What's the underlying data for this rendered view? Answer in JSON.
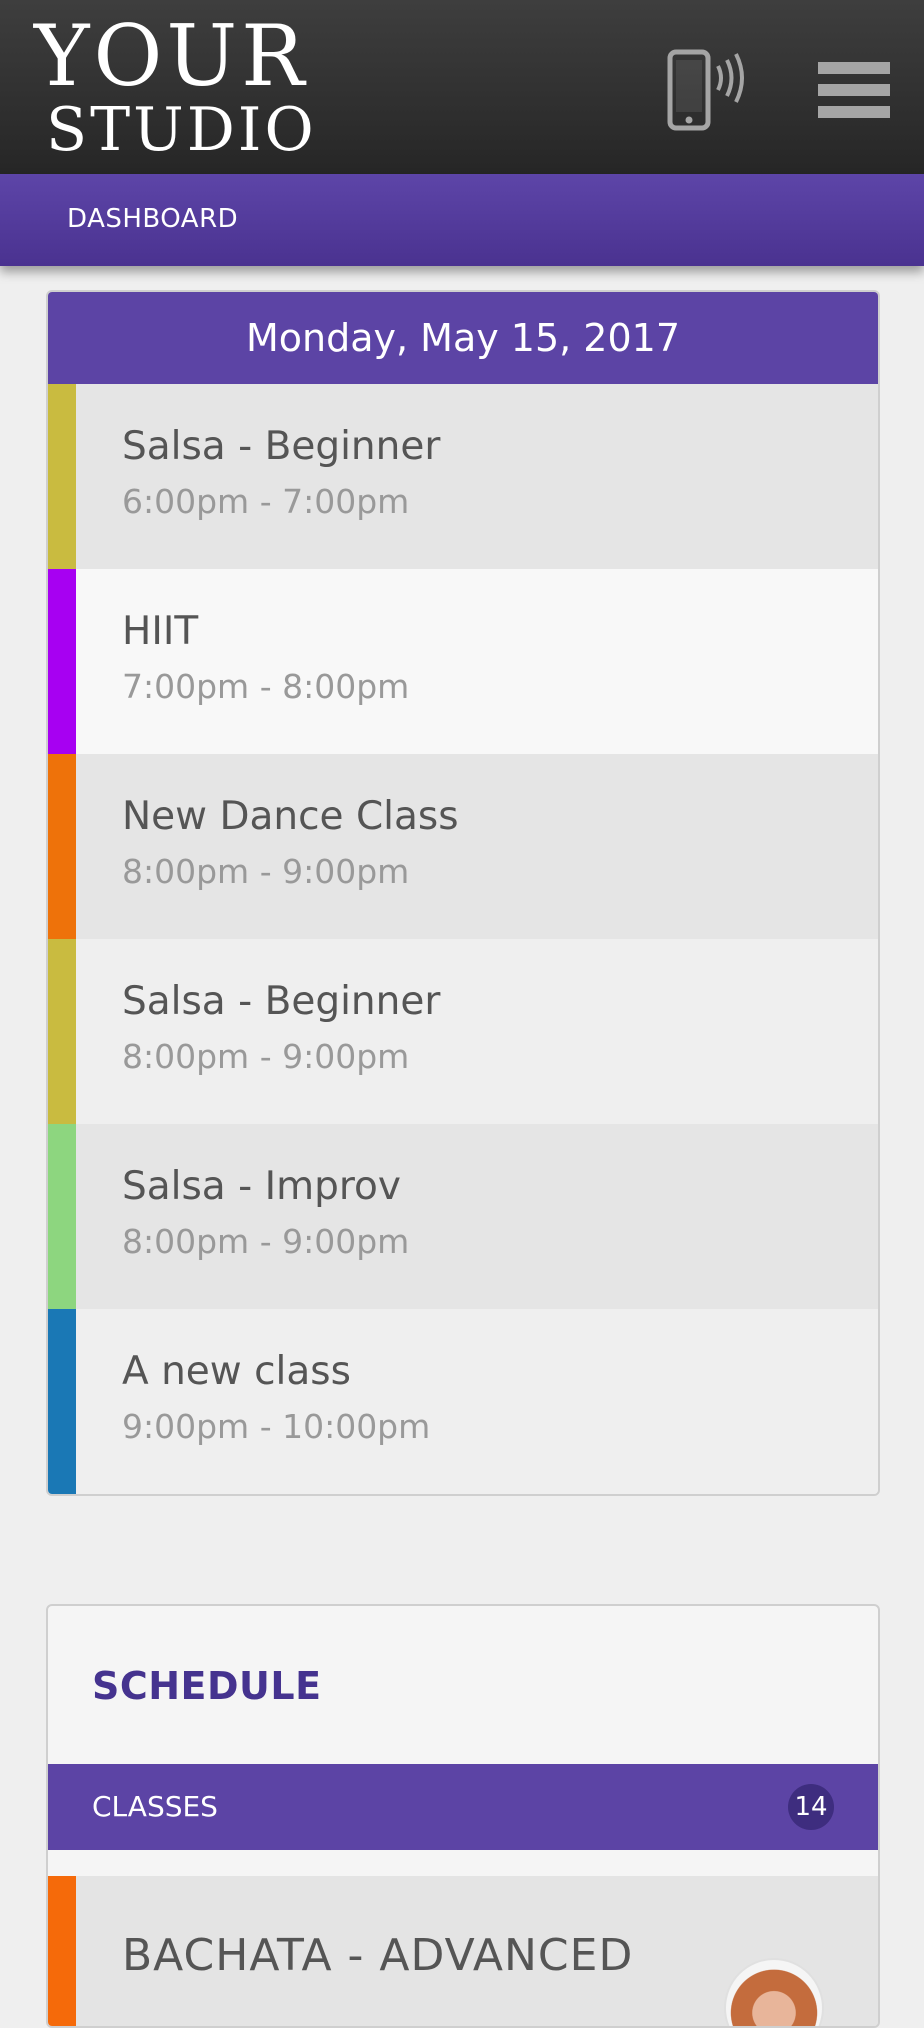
{
  "header": {
    "logo_line1": "YOUR",
    "logo_line2": "STUDIO",
    "phone_icon": "phone-vibrate-icon",
    "menu_icon": "hamburger-menu-icon"
  },
  "nav": {
    "dashboard": "DASHBOARD"
  },
  "day": {
    "date": "Monday, May 15, 2017",
    "classes": [
      {
        "title": "Salsa - Beginner",
        "time": "6:00pm - 7:00pm",
        "color": "#c9bb40",
        "bg": "#e5e5e5"
      },
      {
        "title": "HIIT",
        "time": "7:00pm - 8:00pm",
        "color": "#a700f2",
        "bg": "#f8f8f8"
      },
      {
        "title": "New Dance Class",
        "time": "8:00pm - 9:00pm",
        "color": "#ee720a",
        "bg": "#e5e5e5"
      },
      {
        "title": "Salsa - Beginner",
        "time": "8:00pm - 9:00pm",
        "color": "#c9bb40",
        "bg": "#efefef"
      },
      {
        "title": "Salsa - Improv",
        "time": "8:00pm - 9:00pm",
        "color": "#8dd67f",
        "bg": "#e5e5e5"
      },
      {
        "title": "A new class",
        "time": "9:00pm - 10:00pm",
        "color": "#1a78b5",
        "bg": "#efefef"
      }
    ]
  },
  "schedule": {
    "title": "SCHEDULE",
    "classes_label": "CLASSES",
    "classes_count": "14",
    "first_item": {
      "title": "BACHATA - ADVANCED",
      "color": "#f56a0a"
    }
  },
  "colors": {
    "brand_purple": "#5c44a5",
    "header_dark": "#2e2e2e",
    "title_purple": "#45338f"
  }
}
